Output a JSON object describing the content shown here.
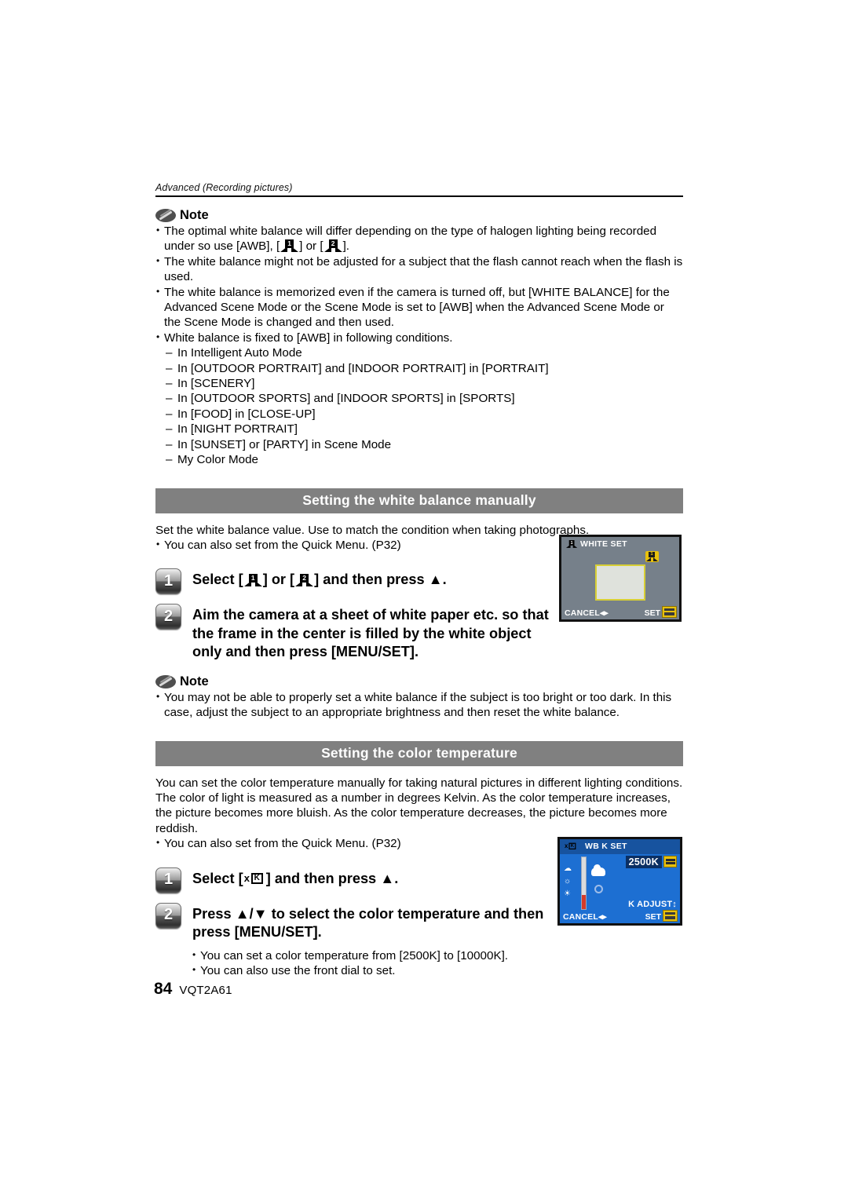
{
  "running_head": "Advanced (Recording pictures)",
  "note_label": "Note",
  "notes_top": [
    "The optimal white balance will differ depending on the type of halogen lighting being recorded under so use [AWB], [ ] or [ ].",
    "The white balance might not be adjusted for a subject that the flash cannot reach when the flash is used.",
    "The white balance is memorized even if the camera is turned off, but [WHITE BALANCE] for the Advanced Scene Mode or the Scene Mode is set to [AWB] when the Advanced Scene Mode or the Scene Mode is changed and then used.",
    "White balance is fixed to [AWB] in following conditions."
  ],
  "note_bullet_1_a": "The optimal white balance will differ depending on the type of halogen lighting being recorded under so use [AWB], [",
  "note_bullet_1_b": "] or [",
  "note_bullet_1_c": "].",
  "note_bullet_2": "The white balance might not be adjusted for a subject that the flash cannot reach when the flash is used.",
  "note_bullet_3": "The white balance is memorized even if the camera is turned off, but [WHITE BALANCE] for the Advanced Scene Mode or the Scene Mode is set to [AWB] when the Advanced Scene Mode or the Scene Mode is changed and then used.",
  "note_bullet_4": "White balance is fixed to [AWB] in following conditions.",
  "awb_conditions": [
    "In Intelligent Auto Mode",
    "In [OUTDOOR PORTRAIT] and [INDOOR PORTRAIT] in [PORTRAIT]",
    "In [SCENERY]",
    "In [OUTDOOR SPORTS] and [INDOOR SPORTS] in [SPORTS]",
    "In [FOOD] in [CLOSE-UP]",
    "In [NIGHT PORTRAIT]",
    "In [SUNSET] or [PARTY] in Scene Mode",
    "My Color Mode"
  ],
  "section_wb": {
    "heading": "Setting the white balance manually",
    "intro": "Set the white balance value. Use to match the condition when taking photographs.",
    "quick_menu_bullet": "You can also set from the Quick Menu. (P32)",
    "step1_num": "1",
    "step1_a": "Select [",
    "step1_b": "] or [",
    "step1_c": "] and then press ▲.",
    "step2_num": "2",
    "step2_text": "Aim the camera at a sheet of white paper etc. so that the frame in the center is filled by the white object only and then press [MENU/SET].",
    "note_bullet": "You may not be able to properly set a white balance if the subject is too bright or too dark. In this case, adjust the subject to an appropriate brightness and then reset the white balance.",
    "lcd": {
      "title": "WHITE SET",
      "cancel": "CANCEL",
      "cancel_arrows": "◂▸",
      "set": "SET",
      "icon_digit": "1"
    }
  },
  "section_ct": {
    "heading": "Setting the color temperature",
    "intro": "You can set the color temperature manually for taking natural pictures in different lighting conditions. The color of light is measured as a number in degrees Kelvin. As the color temperature increases, the picture becomes more bluish. As the color temperature decreases, the picture becomes more reddish.",
    "quick_menu_bullet": "You can also set from the Quick Menu. (P32)",
    "step1_num": "1",
    "step1_a": "Select [",
    "step1_b": "] and then press ▲.",
    "step1_icon_k": "K",
    "step2_num": "2",
    "step2_text": "Press ▲/▼ to select the color temperature and then press [MENU/SET].",
    "bullets": [
      "You can set a color temperature from [2500K] to [10000K].",
      "You can also use the front dial to set."
    ],
    "lcd": {
      "title": "WB K SET",
      "value": "2500K",
      "k_adjust": "K ADJUST↕",
      "cancel": "CANCEL",
      "cancel_arrows": "◂▸",
      "set": "SET"
    }
  },
  "wb_icon_1_digit": "1",
  "wb_icon_2_digit": "2",
  "footer": {
    "page_number": "84",
    "doc_code": "VQT2A61"
  },
  "colors": {
    "section_bar": "#808080",
    "lcd_white_bg": "#76808a",
    "lcd_k_bg": "#1d6fd2",
    "lcd_k_band": "#17539f",
    "accent_yellow": "#e8c10c",
    "frame_yellow": "#d8cf35"
  }
}
